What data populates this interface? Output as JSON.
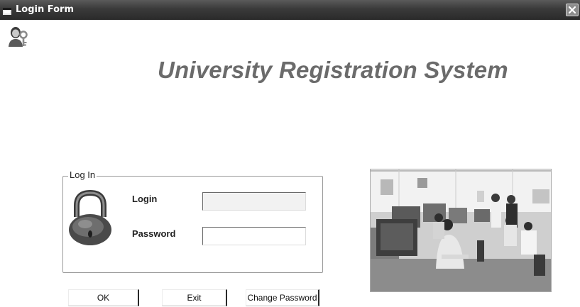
{
  "window": {
    "title": "Login Form"
  },
  "heading": "University Registration System",
  "login_group": {
    "legend": "Log In",
    "login_label": "Login",
    "login_value": "",
    "password_label": "Password",
    "password_value": ""
  },
  "buttons": {
    "ok": "OK",
    "exit": "Exit",
    "change_password": "Change Password"
  },
  "icons": {
    "window_icon": "window-icon",
    "app_icon": "user-key-icon",
    "padlock": "padlock-icon",
    "close": "close-icon"
  },
  "photo": "computer-lab-photo"
}
